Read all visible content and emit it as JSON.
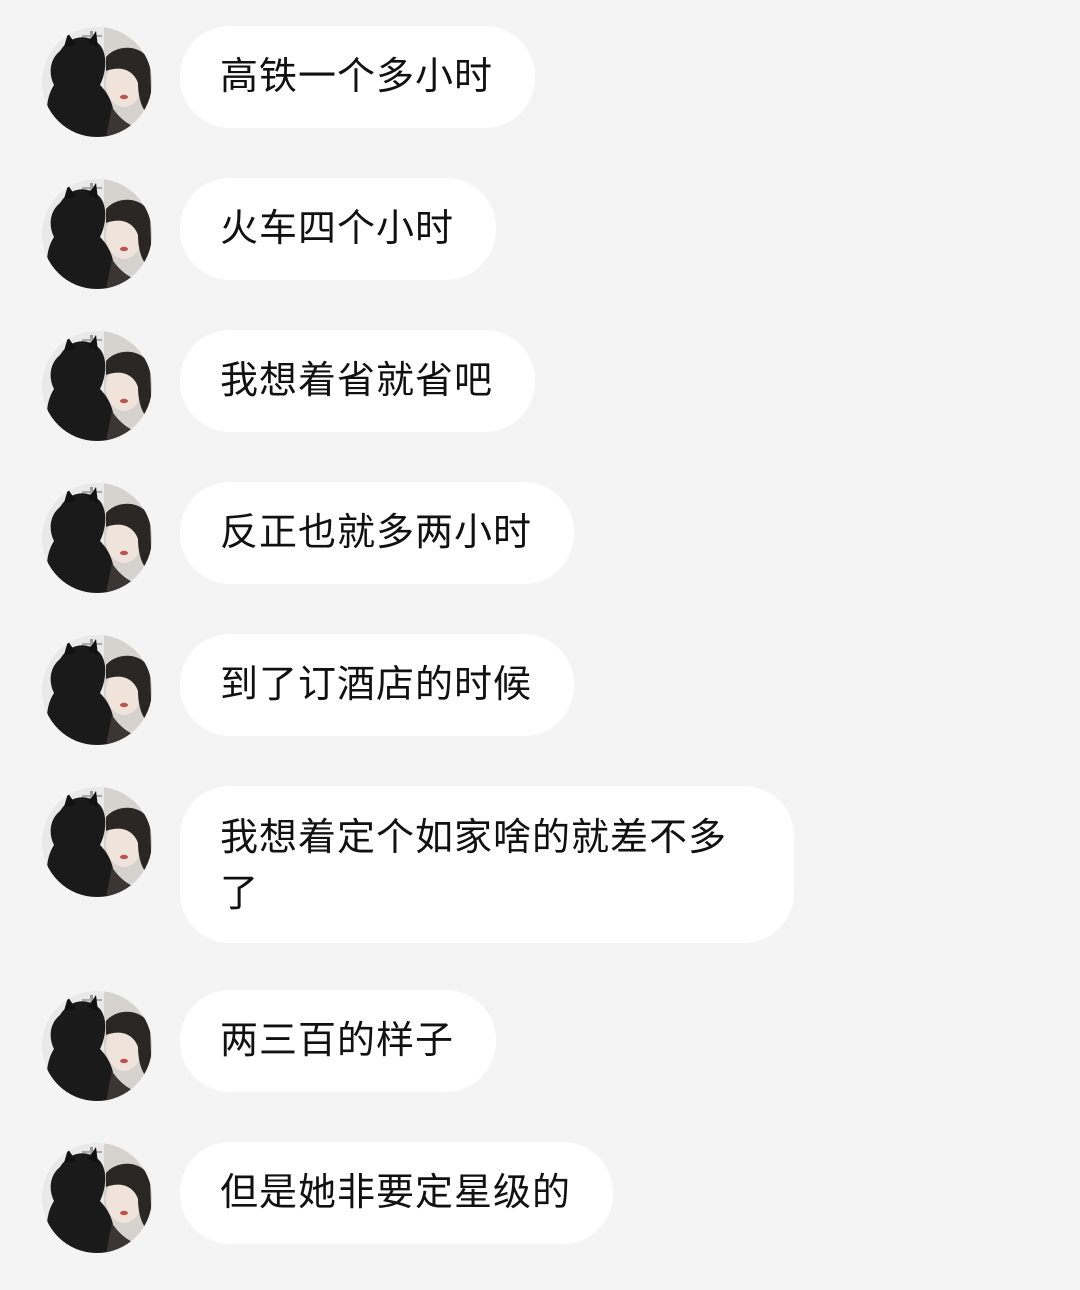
{
  "messages": [
    {
      "sender": "other",
      "avatar": "avatar",
      "text": "高铁一个多小时"
    },
    {
      "sender": "other",
      "avatar": "avatar",
      "text": "火车四个小时"
    },
    {
      "sender": "other",
      "avatar": "avatar",
      "text": "我想着省就省吧"
    },
    {
      "sender": "other",
      "avatar": "avatar",
      "text": "反正也就多两小时"
    },
    {
      "sender": "other",
      "avatar": "avatar",
      "text": "到了订酒店的时候"
    },
    {
      "sender": "other",
      "avatar": "avatar",
      "text": "我想着定个如家啥的就差不多了"
    },
    {
      "sender": "other",
      "avatar": "avatar",
      "text": "两三百的样子"
    },
    {
      "sender": "other",
      "avatar": "avatar",
      "text": "但是她非要定星级的"
    }
  ],
  "colors": {
    "background": "#f4f4f4",
    "bubble": "#ffffff",
    "text": "#111111"
  }
}
